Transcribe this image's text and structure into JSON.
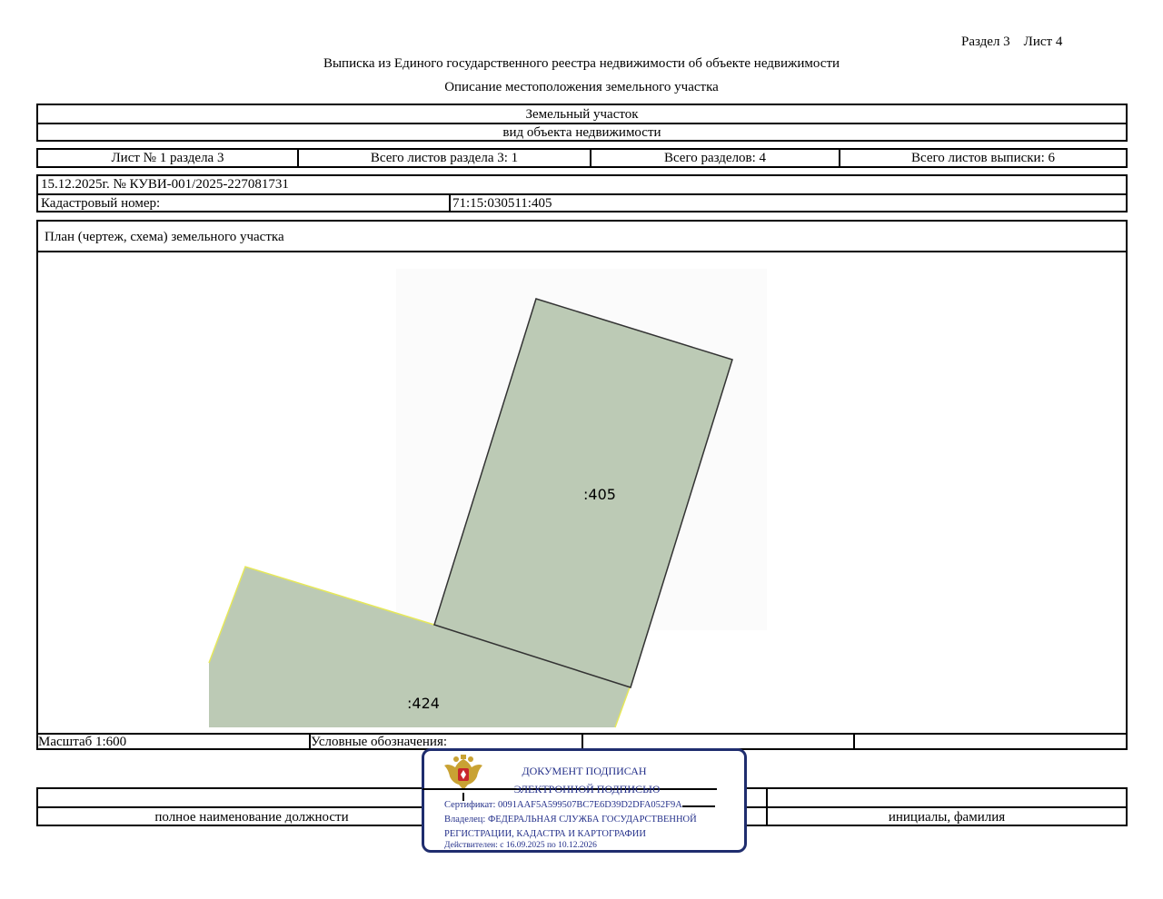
{
  "header": {
    "section_sheet": "Раздел 3    Лист 4",
    "title": "Выписка из Единого государственного реестра недвижимости об объекте недвижимости",
    "subtitle": "Описание местоположения земельного участка"
  },
  "object": {
    "type_value": "Земельный участок",
    "type_caption": "вид объекта недвижимости"
  },
  "sheets_row": {
    "sheet_of_section": "Лист № 1 раздела 3",
    "total_section_sheets": "Всего листов раздела 3: 1",
    "total_sections": "Всего разделов: 4",
    "total_extract_sheets": "Всего листов выписки: 6"
  },
  "record": {
    "date_number": "15.12.2025г. № КУВИ-001/2025-227081731",
    "cadastral_label": "Кадастровый номер:",
    "cadastral_value": "71:15:030511:405"
  },
  "plan": {
    "heading": "План (чертеж, схема) земельного участка",
    "parcels": [
      {
        "label": ":405"
      },
      {
        "label": ":424"
      }
    ],
    "parcel_fill": "#bccab5",
    "scale": "Масштаб 1:600",
    "legend_label": "Условные обозначения:"
  },
  "signature_row": {
    "position_caption": "полное наименование должности",
    "name_caption": "инициалы, фамилия"
  },
  "stamp": {
    "line1": "ДОКУМЕНТ ПОДПИСАН",
    "line2": "ЭЛЕКТРОННОЙ ПОДПИСЬЮ",
    "certificate": "Сертификат: 0091AAF5A599507BC7E6D39D2DFA052F9A",
    "owner_line1": "Владелец: ФЕДЕРАЛЬНАЯ СЛУЖБА ГОСУДАРСТВЕННОЙ",
    "owner_line2": "РЕГИСТРАЦИИ, КАДАСТРА И КАРТОГРАФИИ",
    "valid": "Действителен: с 16.09.2025 по 10.12.2026",
    "border_color": "#1f2d6e",
    "text_color": "#24308a",
    "emblem_icon": "double-headed-eagle-icon"
  }
}
